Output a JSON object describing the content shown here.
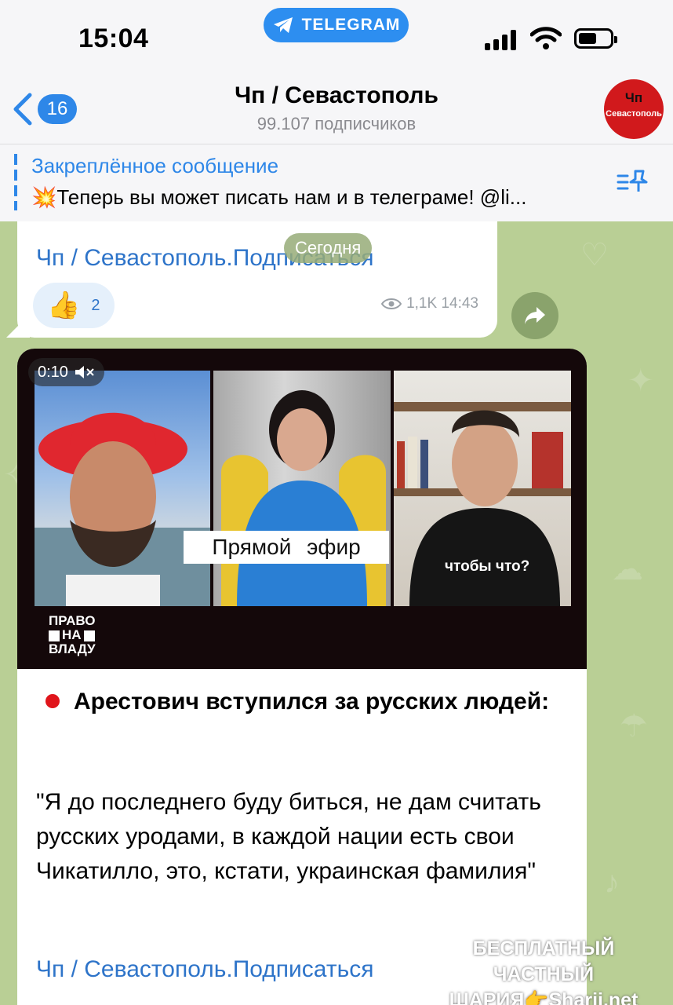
{
  "status_bar": {
    "time": "15:04",
    "telegram_pill": "TELEGRAM"
  },
  "header": {
    "back_count": "16",
    "title": "Чп / Севастополь",
    "subtitle": "99.107 подписчиков",
    "avatar_line1": "Чп",
    "avatar_line2": "Севастополь"
  },
  "pinned": {
    "title": "Закреплённое сообщение",
    "text": "Теперь вы может писать нам и в телеграме! @li..."
  },
  "messages": [
    {
      "link": "Чп / Севастополь.Подписаться",
      "reaction_emoji": "👍",
      "reaction_count": "2",
      "views": "1,1K",
      "time": "14:43"
    },
    {
      "video": {
        "duration": "0:10",
        "overlay": "Прямой эфир",
        "logo": [
          "ПРАВО",
          "НА",
          "ВЛАДУ"
        ]
      },
      "headline": "Арестович вступился за русских людей:",
      "quote": "\"Я до последнего буду биться, не дам считать русских уродами, в каждой нации есть свои Чикатилло, это, кстати, украинская фамилия\"",
      "link": "Чп / Севастополь.Подписаться"
    }
  ],
  "date_pill": "Сегодня",
  "watermark": {
    "line1": "БЕСПЛАТНЫЙ ЧАСТНЫЙ",
    "line2": "ШАРИЯ👉Sharij.net"
  },
  "colors": {
    "accent": "#2e87e8",
    "chat_background": "#b9cf95",
    "link": "#2e74c9"
  }
}
